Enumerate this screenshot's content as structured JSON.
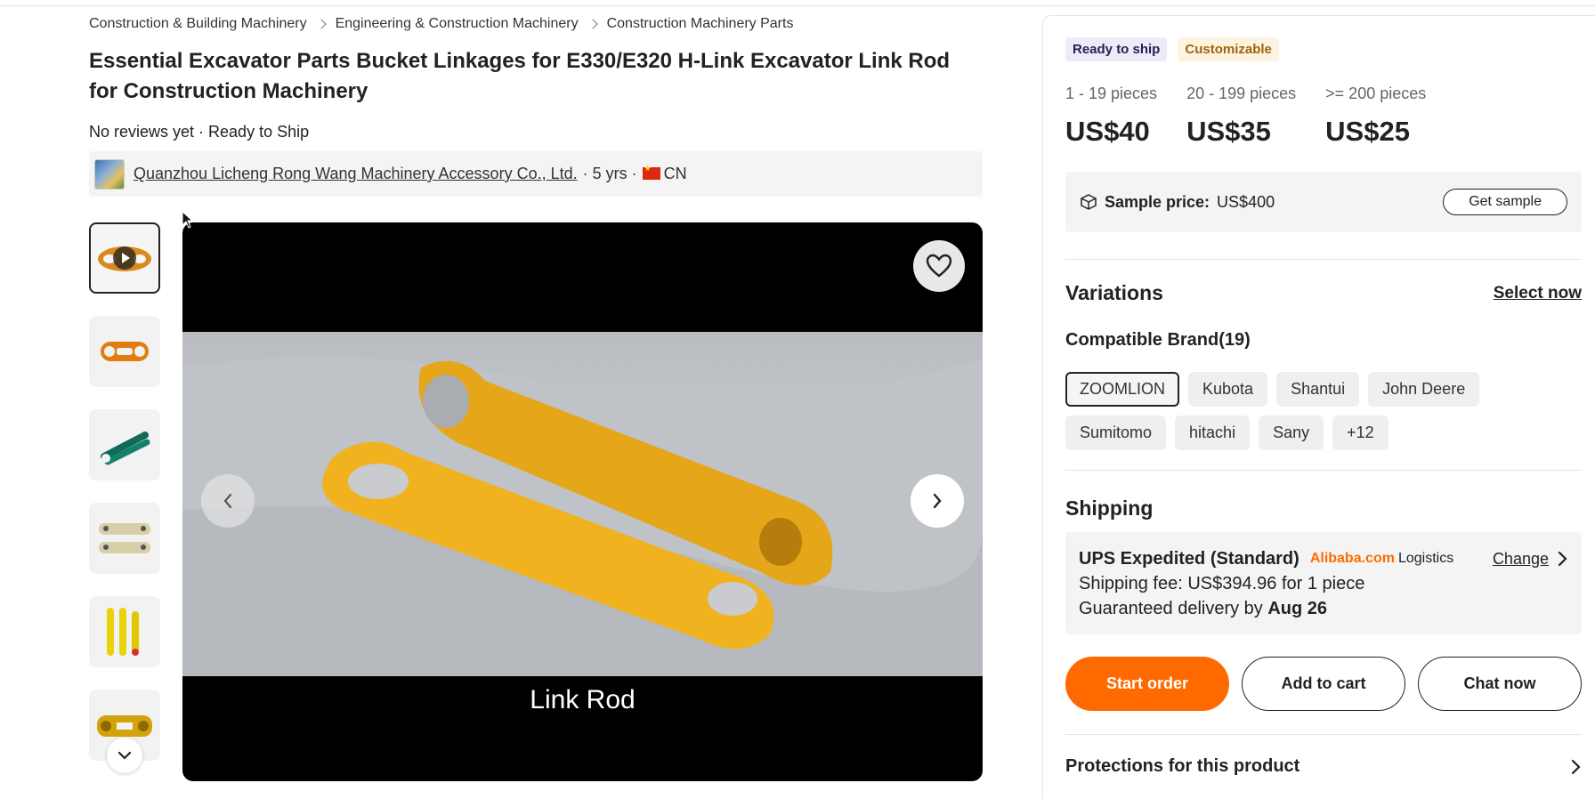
{
  "breadcrumb": [
    "Construction & Building Machinery",
    "Engineering & Construction Machinery",
    "Construction Machinery Parts"
  ],
  "product": {
    "title": "Essential Excavator Parts Bucket Linkages for E330/E320 H-Link Excavator Link Rod for Construction Machinery",
    "meta": "No reviews yet · Ready to Ship"
  },
  "supplier": {
    "name": "Quanzhou Licheng Rong Wang Machinery Accessory Co., Ltd.",
    "years": "· 5 yrs ·",
    "country": "CN"
  },
  "media": {
    "caption": "Link Rod",
    "thumb_icons": [
      "video-thumb",
      "orange-link-thumb",
      "green-link-thumb",
      "beige-link-thumb",
      "yellow-rods-thumb",
      "h-link-thumb"
    ]
  },
  "badges": {
    "ready": "Ready to ship",
    "custom": "Customizable"
  },
  "tiers": [
    {
      "range": "1 - 19 pieces",
      "price": "US$40"
    },
    {
      "range": "20 - 199 pieces",
      "price": "US$35"
    },
    {
      "range": ">= 200 pieces",
      "price": "US$25"
    }
  ],
  "sample": {
    "label": "Sample price:",
    "value": "US$400",
    "button": "Get sample"
  },
  "variations": {
    "heading": "Variations",
    "select": "Select now",
    "brand_heading": "Compatible Brand(19)",
    "brands": [
      "ZOOMLION",
      "Kubota",
      "Shantui",
      "John Deere",
      "Sumitomo",
      "hitachi",
      "Sany",
      "+12"
    ]
  },
  "shipping": {
    "heading": "Shipping",
    "method": "UPS Expedited (Standard)",
    "brand": "Alibaba.com",
    "brand_suffix": "Logistics",
    "change": "Change",
    "fee": "Shipping fee: US$394.96 for 1 piece",
    "delivery_prefix": "Guaranteed delivery by ",
    "delivery_date": "Aug 26"
  },
  "actions": {
    "start": "Start order",
    "cart": "Add to cart",
    "chat": "Chat now"
  },
  "protections": "Protections for this product",
  "colors": {
    "accent": "#ff6a00",
    "ready_bg": "#ecebf7",
    "custom_fg": "#a0620a"
  }
}
